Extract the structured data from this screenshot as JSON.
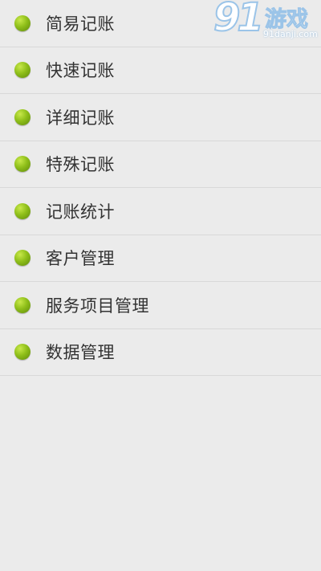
{
  "menu": {
    "items": [
      {
        "label": "简易记账"
      },
      {
        "label": "快速记账"
      },
      {
        "label": "详细记账"
      },
      {
        "label": "特殊记账"
      },
      {
        "label": "记账统计"
      },
      {
        "label": "客户管理"
      },
      {
        "label": "服务项目管理"
      },
      {
        "label": "数据管理"
      }
    ]
  },
  "watermark": {
    "number": "91",
    "brand": "游戏",
    "url": "91danji.com"
  },
  "colors": {
    "background": "#ebebeb",
    "bullet": "#8fbf1a",
    "divider": "#d8d8d8",
    "text": "#333333"
  }
}
